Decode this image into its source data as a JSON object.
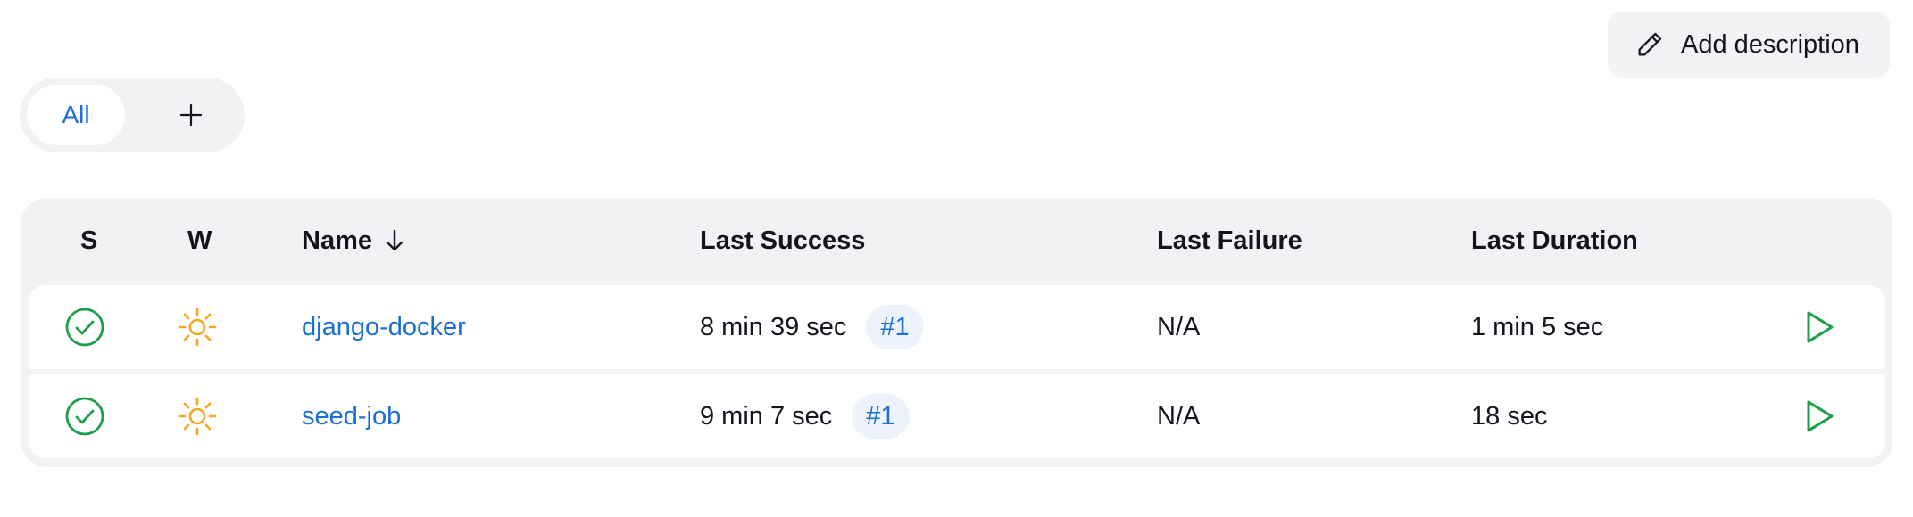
{
  "header": {
    "add_description_label": "Add description"
  },
  "tabs": {
    "all_label": "All",
    "add_tab_icon": "plus-icon"
  },
  "table": {
    "columns": {
      "status": "S",
      "weather": "W",
      "name": "Name",
      "name_sort_icon": "arrow-down-icon",
      "last_success": "Last Success",
      "last_failure": "Last Failure",
      "last_duration": "Last Duration"
    },
    "rows": [
      {
        "status_icon": "check-circle-icon",
        "weather_icon": "sun-icon",
        "name": "django-docker",
        "last_success": "8 min 39 sec",
        "last_success_build": "#1",
        "last_failure": "N/A",
        "last_duration": "1 min 5 sec",
        "action_icon": "play-icon"
      },
      {
        "status_icon": "check-circle-icon",
        "weather_icon": "sun-icon",
        "name": "seed-job",
        "last_success": "9 min 7 sec",
        "last_success_build": "#1",
        "last_failure": "N/A",
        "last_duration": "18 sec",
        "action_icon": "play-icon"
      }
    ]
  },
  "colors": {
    "link": "#1a6fd6",
    "success": "#1e9e4a",
    "weather_sun": "#f5a623",
    "panel_bg": "#f2f2f5"
  }
}
